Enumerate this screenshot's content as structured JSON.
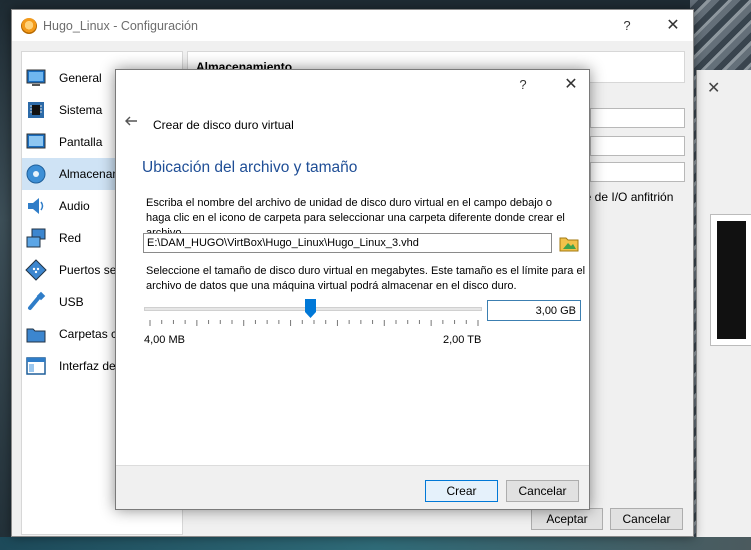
{
  "settings_window": {
    "title": "Hugo_Linux - Configuración",
    "help_glyph": "?",
    "close_glyph": "✕",
    "section_label": "Almacenamiento",
    "host_io_fragment": "he de I/O anfitrión",
    "accept_label": "Aceptar",
    "cancel_label": "Cancelar"
  },
  "sidebar": {
    "items": [
      {
        "label": "General",
        "icon": "monitor-icon"
      },
      {
        "label": "Sistema",
        "icon": "chip-icon"
      },
      {
        "label": "Pantalla",
        "icon": "display-icon"
      },
      {
        "label": "Almacenam",
        "icon": "disk-icon",
        "active": true
      },
      {
        "label": "Audio",
        "icon": "speaker-icon"
      },
      {
        "label": "Red",
        "icon": "network-icon"
      },
      {
        "label": "Puertos ser",
        "icon": "serial-port-icon"
      },
      {
        "label": "USB",
        "icon": "usb-icon"
      },
      {
        "label": "Carpetas co",
        "icon": "folder-icon"
      },
      {
        "label": "Interfaz de",
        "icon": "window-icon"
      }
    ]
  },
  "dialog": {
    "help_glyph": "?",
    "close_glyph": "✕",
    "back_icon": "back-arrow-icon",
    "title": "Crear de disco duro virtual",
    "heading": "Ubicación del archivo y tamaño",
    "path_description": "Escriba el nombre del archivo de unidad de disco duro virtual en el campo debajo o haga clic en el icono de carpeta para seleccionar una carpeta diferente donde crear el archivo.",
    "path_value": "E:\\DAM_HUGO\\VirtBox\\Hugo_Linux\\Hugo_Linux_3.vhd",
    "size_description": "Seleccione el tamaño de disco duro virtual en megabytes. Este tamaño es el límite para el archivo de datos que una máquina virtual podrá almacenar en el disco duro.",
    "size_value": "3,00 GB",
    "size_min_label": "4,00 MB",
    "size_max_label": "2,00 TB",
    "slider_position": 0.49,
    "create_label": "Crear",
    "cancel_label": "Cancelar"
  },
  "colors": {
    "accent": "#0078d7",
    "heading": "#1f4e96",
    "active_sidebar": "#cfe3f5"
  }
}
